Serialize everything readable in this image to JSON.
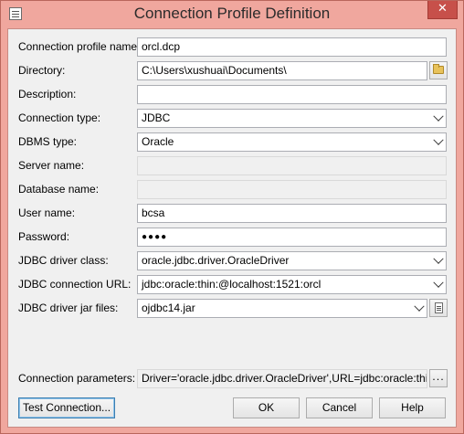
{
  "window": {
    "title": "Connection Profile Definition",
    "close_symbol": "✕"
  },
  "labels": {
    "profile_name": "Connection profile name:",
    "directory": "Directory:",
    "description": "Description:",
    "connection_type": "Connection type:",
    "dbms_type": "DBMS type:",
    "server_name": "Server name:",
    "database_name": "Database name:",
    "user_name": "User name:",
    "password": "Password:",
    "driver_class": "JDBC driver class:",
    "connection_url": "JDBC connection URL:",
    "driver_jar": "JDBC driver jar files:",
    "connection_params": "Connection parameters:"
  },
  "values": {
    "profile_name": "orcl.dcp",
    "directory": "C:\\Users\\xushuai\\Documents\\",
    "description": "",
    "connection_type": "JDBC",
    "dbms_type": "Oracle",
    "server_name": "",
    "database_name": "",
    "user_name": "bcsa",
    "password": "●●●●",
    "driver_class": "oracle.jdbc.driver.OracleDriver",
    "connection_url": "jdbc:oracle:thin:@localhost:1521:orcl",
    "driver_jar": "ojdbc14.jar",
    "connection_params": "Driver='oracle.jdbc.driver.OracleDriver',URL=jdbc:oracle:thin:@loc"
  },
  "buttons": {
    "test": "Test Connection...",
    "ok": "OK",
    "cancel": "Cancel",
    "help": "Help",
    "params_browse": "..."
  }
}
